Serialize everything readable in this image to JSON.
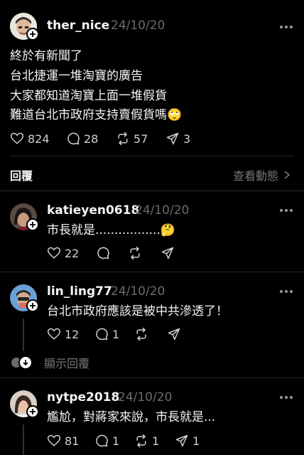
{
  "post": {
    "username": "ther_nice",
    "date": "24/10/20",
    "lines": [
      "終於有新聞了",
      "台北捷運一堆淘寶的廣告",
      "大家都知道淘寶上面一堆假貨",
      "難道台北市政府支持賣假貨嗎🙄"
    ],
    "likes": "824",
    "comments": "28",
    "reposts": "57",
    "shares": "3"
  },
  "section": {
    "replies_label": "回覆",
    "view_activity_label": "查看動態"
  },
  "replies": [
    {
      "username": "katieyen0618",
      "date": "24/10/20",
      "text": "市長就是.................🤔",
      "likes": "22",
      "comments": "",
      "reposts": "",
      "shares": ""
    },
    {
      "username": "lin_ling77",
      "date": "24/10/20",
      "text": "台北市政府應該是被中共滲透了！",
      "likes": "12",
      "comments": "1",
      "reposts": "",
      "shares": ""
    },
    {
      "username": "nytpe2018",
      "date": "24/10/20",
      "text": "尷尬，對蔣家來說，市長就是...",
      "likes": "81",
      "comments": "1",
      "reposts": "1",
      "shares": "1"
    }
  ],
  "show_replies_label": "顯示回覆"
}
